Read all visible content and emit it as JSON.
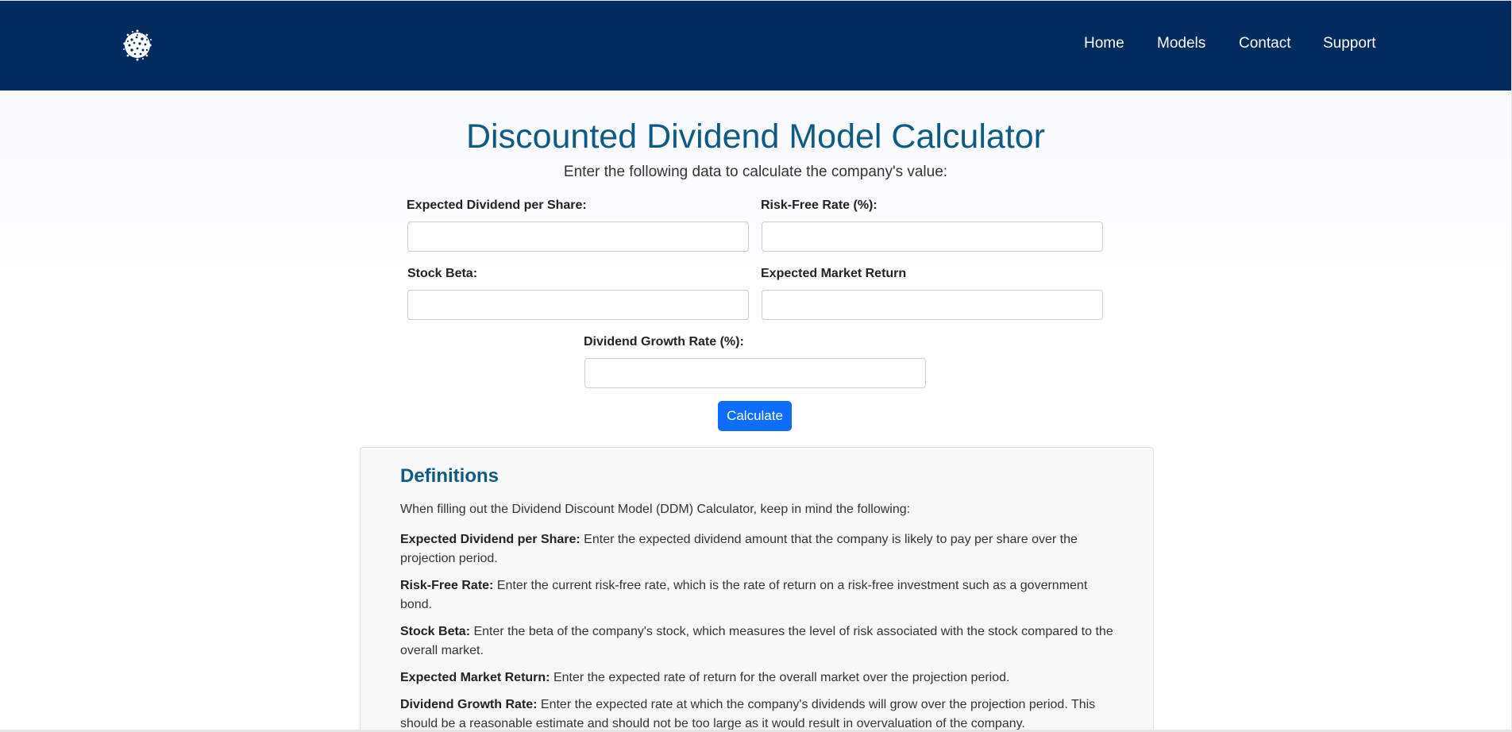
{
  "nav": {
    "logo_icon": "coral-globe-logo-icon",
    "links": [
      "Home",
      "Models",
      "Contact",
      "Support"
    ]
  },
  "page": {
    "title": "Discounted Dividend Model Calculator",
    "subtitle": "Enter the following data to calculate the company's value:"
  },
  "form": {
    "fields": [
      {
        "label": "Expected Dividend per Share:",
        "value": "",
        "placeholder": ""
      },
      {
        "label": "Risk-Free Rate (%):",
        "value": "",
        "placeholder": ""
      },
      {
        "label": "Stock Beta:",
        "value": "",
        "placeholder": ""
      },
      {
        "label": "Expected Market Return",
        "value": "",
        "placeholder": ""
      },
      {
        "label": "Dividend Growth Rate (%):",
        "value": "",
        "placeholder": ""
      }
    ],
    "calculate_label": "Calculate"
  },
  "definitions": {
    "heading": "Definitions",
    "intro": "When filling out the Dividend Discount Model (DDM) Calculator, keep in mind the following:",
    "items": [
      {
        "term": "Expected Dividend per Share:",
        "text": " Enter the expected dividend amount that the company is likely to pay per share over the projection period."
      },
      {
        "term": "Risk-Free Rate:",
        "text": " Enter the current risk-free rate, which is the rate of return on a risk-free investment such as a government bond."
      },
      {
        "term": "Stock Beta:",
        "text": " Enter the beta of the company's stock, which measures the level of risk associated with the stock compared to the overall market."
      },
      {
        "term": "Expected Market Return:",
        "text": " Enter the expected rate of return for the overall market over the projection period."
      },
      {
        "term": "Dividend Growth Rate:",
        "text": " Enter the expected rate at which the company's dividends will grow over the projection period. This should be a reasonable estimate and should not be too large as it would result in overvaluation of the company."
      }
    ]
  },
  "colors": {
    "navbar": "#002b5e",
    "title": "#0f5a84",
    "button": "#0d6efd",
    "panel": "#f8f8f8"
  }
}
